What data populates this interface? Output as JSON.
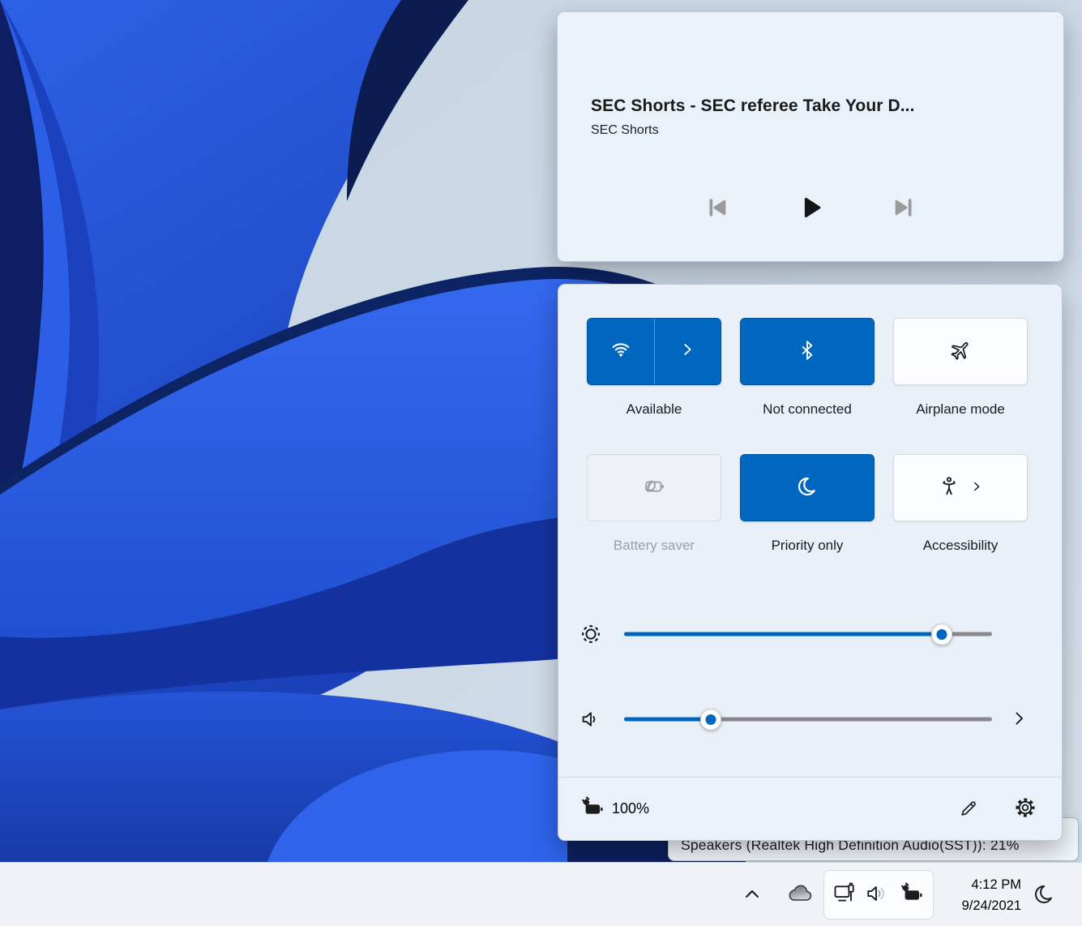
{
  "desktop": {
    "wallpaper": "windows-11-bloom"
  },
  "media_card": {
    "title": "SEC Shorts - SEC referee Take Your D...",
    "subtitle": "SEC Shorts",
    "controls": {
      "previous_icon": "previous-track-icon",
      "play_icon": "play-icon",
      "next_icon": "next-track-icon"
    }
  },
  "quick_settings": {
    "toggles": [
      {
        "label": "Available",
        "icon": "wifi-icon",
        "state": "on",
        "expandable": true
      },
      {
        "label": "Not connected",
        "icon": "bluetooth-icon",
        "state": "on",
        "expandable": false
      },
      {
        "label": "Airplane mode",
        "icon": "airplane-icon",
        "state": "off",
        "expandable": false
      },
      {
        "label": "Battery saver",
        "icon": "battery-saver-icon",
        "state": "disabled",
        "expandable": false
      },
      {
        "label": "Priority only",
        "icon": "moon-icon",
        "state": "on",
        "expandable": false
      },
      {
        "label": "Accessibility",
        "icon": "accessibility-icon",
        "state": "off",
        "expandable": true
      }
    ],
    "brightness": {
      "icon": "brightness-icon",
      "pct": "86.4%"
    },
    "volume": {
      "icon": "speaker-icon",
      "pct": "23.5%",
      "expandable": true
    },
    "footer": {
      "battery_icon": "battery-charging-icon",
      "battery_level": "100%",
      "edit_icon": "pencil-icon",
      "settings_icon": "gear-icon"
    }
  },
  "volume_flyout": {
    "text": "Speakers (Realtek High Definition Audio(SST)): 21%"
  },
  "taskbar": {
    "overflow_icon": "chevron-up-icon",
    "onedrive_icon": "cloud-icon",
    "tray_icons": [
      "monitor-usb-icon",
      "speaker-waves-icon",
      "battery-charging-icon"
    ],
    "clock": {
      "time": "4:12 PM",
      "date": "9/24/2021"
    },
    "focus_assist_icon": "moon-icon"
  },
  "colors": {
    "accent": "#0067c0",
    "panel_bg": "#e9f0f8",
    "card_bg": "#e9f1f9",
    "desktop_bg": "#ccd9e6",
    "taskbar_bg": "#eff2f7",
    "slider_gray": "#87898c",
    "disabled_text": "#9aa0a6"
  }
}
